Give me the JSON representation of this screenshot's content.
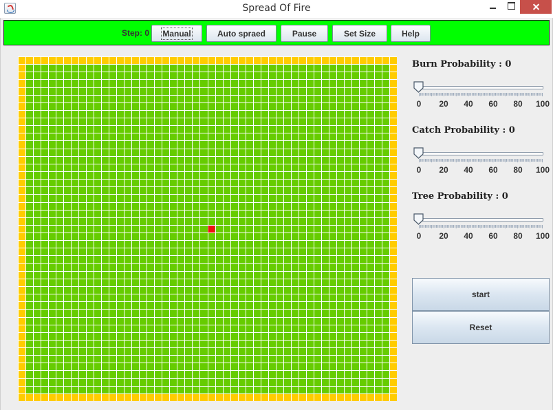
{
  "window": {
    "title": "Spread Of Fire"
  },
  "toolbar": {
    "step_label": "Step: 0",
    "buttons": {
      "manual": "Manual",
      "auto_spread": "Auto spraed",
      "pause": "Pause",
      "set_size": "Set Size",
      "help": "Help"
    }
  },
  "sliders": {
    "burn": {
      "label": "Burn Probability : 0",
      "value": 0
    },
    "catch": {
      "label": "Catch Probability : 0",
      "value": 0
    },
    "tree": {
      "label": "Tree Probability : 0",
      "value": 0
    },
    "tick_labels": [
      "0",
      "20",
      "40",
      "60",
      "80",
      "100"
    ]
  },
  "actions": {
    "start": "start",
    "reset": "Reset"
  },
  "grid": {
    "cols": 50,
    "rows": 45,
    "burning_cell": {
      "col": 25,
      "row": 22
    },
    "colors": {
      "tree": "#66cc00",
      "border": "#ffcc00",
      "burning": "#ee1111",
      "line": "#ffffff"
    }
  },
  "colors": {
    "toolbar_bg": "#00ff00",
    "close_btn": "#c7504a"
  }
}
